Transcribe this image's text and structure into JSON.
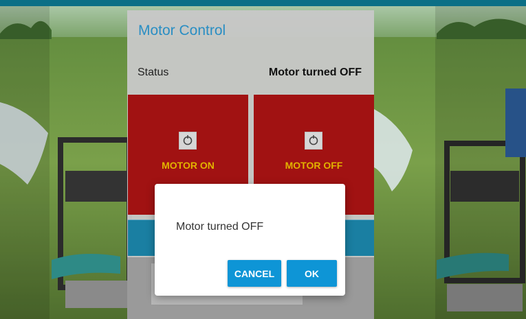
{
  "card": {
    "title": "Motor Control",
    "status_label": "Status",
    "status_value": "Motor turned OFF"
  },
  "buttons": {
    "motor_on": "MOTOR ON",
    "motor_off": "MOTOR OFF"
  },
  "icons": {
    "motor_on_icon": "power-icon",
    "motor_off_icon": "power-icon"
  },
  "dialog": {
    "message": "Motor turned OFF",
    "cancel_label": "CANCEL",
    "ok_label": "OK"
  },
  "colors": {
    "title_blue": "#2a8ec3",
    "motor_button_red": "#a11212",
    "motor_label_yellow": "#e2b300",
    "dialog_button_blue": "#0e95d6",
    "header_bar": "#0b6f86"
  }
}
